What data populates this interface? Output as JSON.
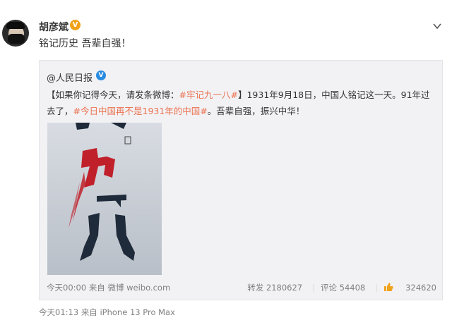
{
  "post": {
    "author": "胡彦斌",
    "badge": "V",
    "text": "铭记历史 吾辈自强！",
    "meta": {
      "time": "今天01:13",
      "from_label": "来自",
      "device": "iPhone 13 Pro Max"
    }
  },
  "quoted": {
    "author": "@人民日报",
    "badge": "V",
    "text": {
      "part1": "【如果你记得今天，请发条微博：",
      "tag1": "#牢记九一八#",
      "part2": "】1931年9月18日，中国人铭记这一天。91年过去了，",
      "tag2": "#今日中国再不是1931年的中国#",
      "part3": "。吾辈自强，振兴中华！"
    },
    "poster": {
      "description_icon": "poster-image"
    },
    "footer": {
      "time": "今天00:00",
      "from_label": "来自",
      "source": "微博 weibo.com",
      "repost": "转发 2180627",
      "comment": "评论 54408",
      "likes": "324620"
    }
  },
  "colors": {
    "link": "#eb7350",
    "muted": "#808080",
    "v_orange": "#f0a21a",
    "v_blue": "#2a8be0"
  }
}
